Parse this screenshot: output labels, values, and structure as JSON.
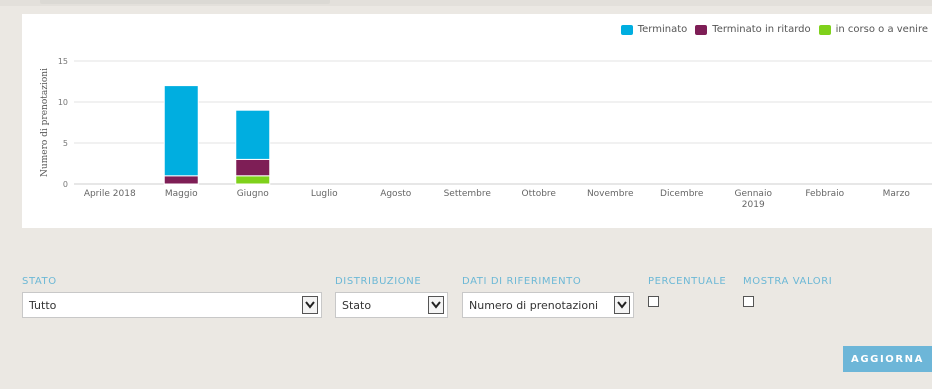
{
  "legend": [
    {
      "label": "Terminato",
      "color": "#00aee0"
    },
    {
      "label": "Terminato in ritardo",
      "color": "#7e1e56"
    },
    {
      "label": "in corso o a venire",
      "color": "#7fd11b"
    }
  ],
  "chart_data": {
    "type": "bar",
    "stacked": true,
    "ylabel": "Numero di prenotazioni",
    "xlabel": "",
    "ylim": [
      0,
      15
    ],
    "yticks": [
      0,
      5,
      10,
      15
    ],
    "grid": true,
    "legend_position": "top-right",
    "categories": [
      "Aprile 2018",
      "Maggio",
      "Giugno",
      "Luglio",
      "Agosto",
      "Settembre",
      "Ottobre",
      "Novembre",
      "Dicembre",
      "Gennaio 2019",
      "Febbraio",
      "Marzo"
    ],
    "series": [
      {
        "name": "in corso o a venire",
        "color": "#7fd11b",
        "values": [
          0,
          0,
          1,
          0,
          0,
          0,
          0,
          0,
          0,
          0,
          0,
          0
        ]
      },
      {
        "name": "Terminato in ritardo",
        "color": "#7e1e56",
        "values": [
          0,
          1,
          2,
          0,
          0,
          0,
          0,
          0,
          0,
          0,
          0,
          0
        ]
      },
      {
        "name": "Terminato",
        "color": "#00aee0",
        "values": [
          0,
          11,
          6,
          0,
          0,
          0,
          0,
          0,
          0,
          0,
          0,
          0
        ]
      }
    ]
  },
  "filters": {
    "stato": {
      "label": "STATO",
      "value": "Tutto"
    },
    "distribuzione": {
      "label": "DISTRIBUZIONE",
      "value": "Stato"
    },
    "dati": {
      "label": "DATI DI RIFERIMENTO",
      "value": "Numero di prenotazioni"
    },
    "percentuale": {
      "label": "PERCENTUALE"
    },
    "mostra": {
      "label": "MOSTRA VALORI"
    }
  },
  "button": {
    "label": "AGGIORNA"
  }
}
